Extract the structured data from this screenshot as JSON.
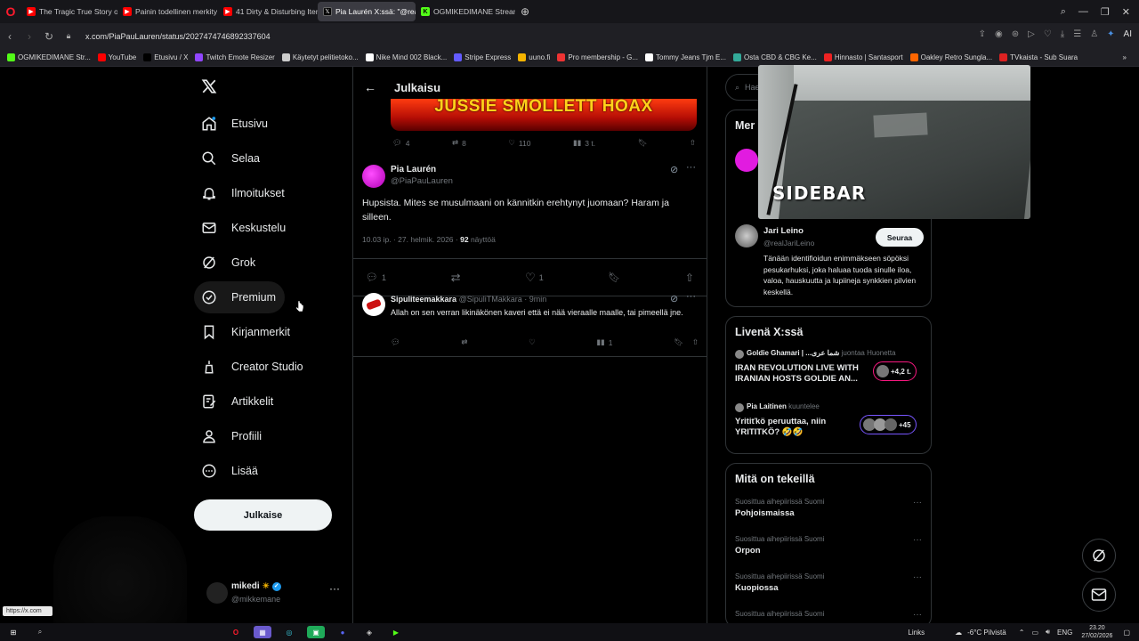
{
  "browser": {
    "tabs": [
      {
        "label": "The Tragic True Story of Ju",
        "color": "#ff0000"
      },
      {
        "label": "Painin todellinen merkity",
        "color": "#ff0000"
      },
      {
        "label": "41 Dirty & Disturbing Item",
        "color": "#ff0000"
      },
      {
        "label": "Pia Laurén X:ssä: \"@realJ",
        "color": "#000000"
      },
      {
        "label": "OGMIKEDIMANE Stream",
        "color": "#53fc18"
      }
    ],
    "url": "x.com/PiaPauLauren/status/2027474746892337604",
    "bookmarks": [
      {
        "label": "OGMIKEDIMANE Str...",
        "color": "#53fc18"
      },
      {
        "label": "YouTube",
        "color": "#ff0000"
      },
      {
        "label": "Etusivu / X",
        "color": "#000000"
      },
      {
        "label": "Twitch Emote Resizer",
        "color": "#9146ff"
      },
      {
        "label": "Käytetyt pelitietoko...",
        "color": "#cccccc"
      },
      {
        "label": "Nike Mind 002 Black...",
        "color": "#ffffff"
      },
      {
        "label": "Stripe Express",
        "color": "#635bff"
      },
      {
        "label": "uuno.fi",
        "color": "#f5b400"
      },
      {
        "label": "Pro membership - G...",
        "color": "#e33"
      },
      {
        "label": "Tommy Jeans Tjm E...",
        "color": "#ffffff"
      },
      {
        "label": "Osta CBD & CBG Ke...",
        "color": "#3a9"
      },
      {
        "label": "Hinnasto | Santasport",
        "color": "#e22"
      },
      {
        "label": "Oakley Retro Sungla...",
        "color": "#f60"
      },
      {
        "label": "TVkaista - Sub Suara",
        "color": "#d22"
      }
    ]
  },
  "sidebar": {
    "items": [
      {
        "label": "Etusivu",
        "icon": "home-icon"
      },
      {
        "label": "Selaa",
        "icon": "search-icon"
      },
      {
        "label": "Ilmoitukset",
        "icon": "bell-icon"
      },
      {
        "label": "Keskustelu",
        "icon": "mail-icon"
      },
      {
        "label": "Grok",
        "icon": "grok-icon"
      },
      {
        "label": "Premium",
        "icon": "premium-icon"
      },
      {
        "label": "Kirjanmerkit",
        "icon": "bookmark-icon"
      },
      {
        "label": "Creator Studio",
        "icon": "creator-icon"
      },
      {
        "label": "Artikkelit",
        "icon": "article-icon"
      },
      {
        "label": "Profiili",
        "icon": "profile-icon"
      },
      {
        "label": "Lisää",
        "icon": "more-icon"
      }
    ],
    "post_button": "Julkaise",
    "account": {
      "name": "mikedi",
      "handle": "@mikkemane"
    }
  },
  "main": {
    "header": "Julkaisu",
    "banner_text": "JUSSIE SMOLLETT HOAX",
    "prev_actions": {
      "replies": "4",
      "reposts": "8",
      "likes": "110",
      "views": "3 t."
    },
    "tweet": {
      "name": "Pia Laurén",
      "handle": "@PiaPauLauren",
      "text": "Hupsista. Mites se musulmaani on kännitkin erehtynyt juomaan? Haram ja silleen.",
      "time": "10.03 ip. · 27. helmik. 2026 ·",
      "views_count": "92",
      "views_label": "näyttöä",
      "replies": "1",
      "likes": "1"
    },
    "reply": {
      "name": "Sipuliteemakkara",
      "handle": "@SipuliTMakkara · 9min",
      "text": "Allah on sen verran likinäkönen kaveri että ei nää vieraalle maalle, tai pimeellä jne.",
      "views": "1"
    }
  },
  "right": {
    "search_placeholder": "Hae",
    "who_to_follow_title": "Mer",
    "follow": {
      "name": "Jari Leino",
      "handle": "@realJariLeino",
      "button": "Seuraa",
      "bio": "Tänään identifioidun enimmäkseen söpöksi pesukarhuksi, joka haluaa tuoda sinulle iloa, valoa, hauskuutta ja lupiineja synkkien pilvien keskellä."
    },
    "live": {
      "title": "Livenä X:ssä",
      "items": [
        {
          "host": "Goldie Ghamari | ...شما عرى",
          "status": "juontaa Huonetta",
          "title": "IRAN REVOLUTION LIVE WITH IRANIAN HOSTS GOLDIE AN...",
          "count": "+4,2 t.",
          "accent": "#f91880"
        },
        {
          "host": "Pia Laitinen",
          "status": "kuuntelee",
          "title": "Yritiťkö peruuttaa, niin YRITITKÖ? 🤣🤣",
          "count": "+45",
          "accent": "#7856ff"
        }
      ]
    },
    "trends": {
      "title": "Mitä on tekeillä",
      "items": [
        {
          "category": "Suosittua aihepiirissä Suomi",
          "topic": "Pohjoismaissa"
        },
        {
          "category": "Suosittua aihepiirissä Suomi",
          "topic": "Orpon"
        },
        {
          "category": "Suosittua aihepiirissä Suomi",
          "topic": "Kuopiossa"
        },
        {
          "category": "Suosittua aihepiirissä Suomi",
          "topic": ""
        }
      ]
    }
  },
  "webcam": {
    "overlay_text": "SIDEBAR"
  },
  "taskbar": {
    "links_label": "Links",
    "weather": "-6°C  Pilvistä",
    "lang": "ENG",
    "time": "23.20",
    "date": "27/02/2026"
  },
  "status_url": "https://x.com"
}
